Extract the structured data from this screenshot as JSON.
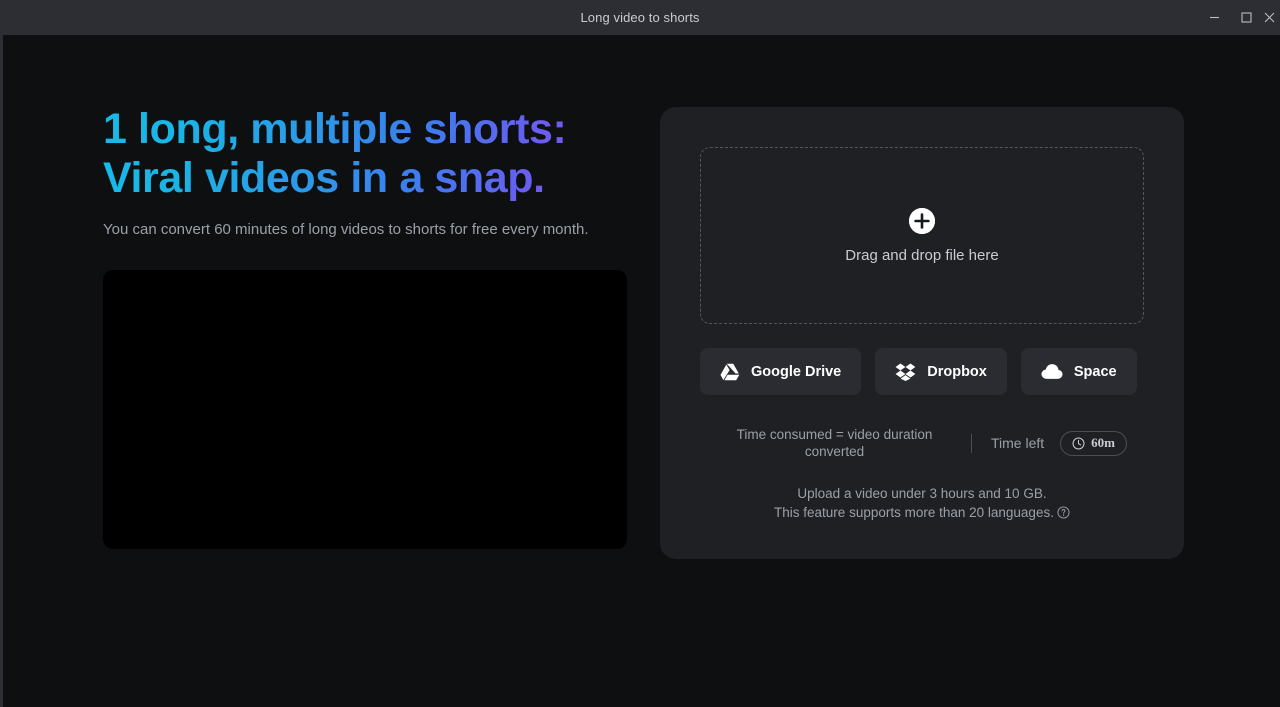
{
  "window": {
    "title": "Long video to shorts",
    "controls": [
      {
        "name": "minimize",
        "icon": "minimize-icon"
      },
      {
        "name": "maximize",
        "icon": "maximize-icon"
      },
      {
        "name": "close",
        "icon": "close-icon"
      }
    ]
  },
  "hero": {
    "headline": "1 long, multiple shorts: Viral videos in a snap.",
    "subtitle": "You can convert 60 minutes of long videos to shorts for free every month.",
    "gradient_start": "#18b9e8",
    "gradient_end": "#8457f5",
    "video_placeholder": ""
  },
  "upload": {
    "dropzone_label": "Drag and drop file here",
    "plus_icon": "plus-icon",
    "services": [
      {
        "label": "Google Drive",
        "icon": "google-drive-icon"
      },
      {
        "label": "Dropbox",
        "icon": "dropbox-icon"
      },
      {
        "label": "Space",
        "icon": "cloud-icon"
      }
    ],
    "time_consumed": "Time consumed = video duration converted",
    "time_left_label": "Time left",
    "time_left_value": "60m",
    "clock_icon": "clock-icon",
    "note_line1": "Upload a video under 3 hours and 10 GB.",
    "note_line2": "This feature supports more than 20 languages.",
    "help_icon": "question-circle-icon"
  }
}
